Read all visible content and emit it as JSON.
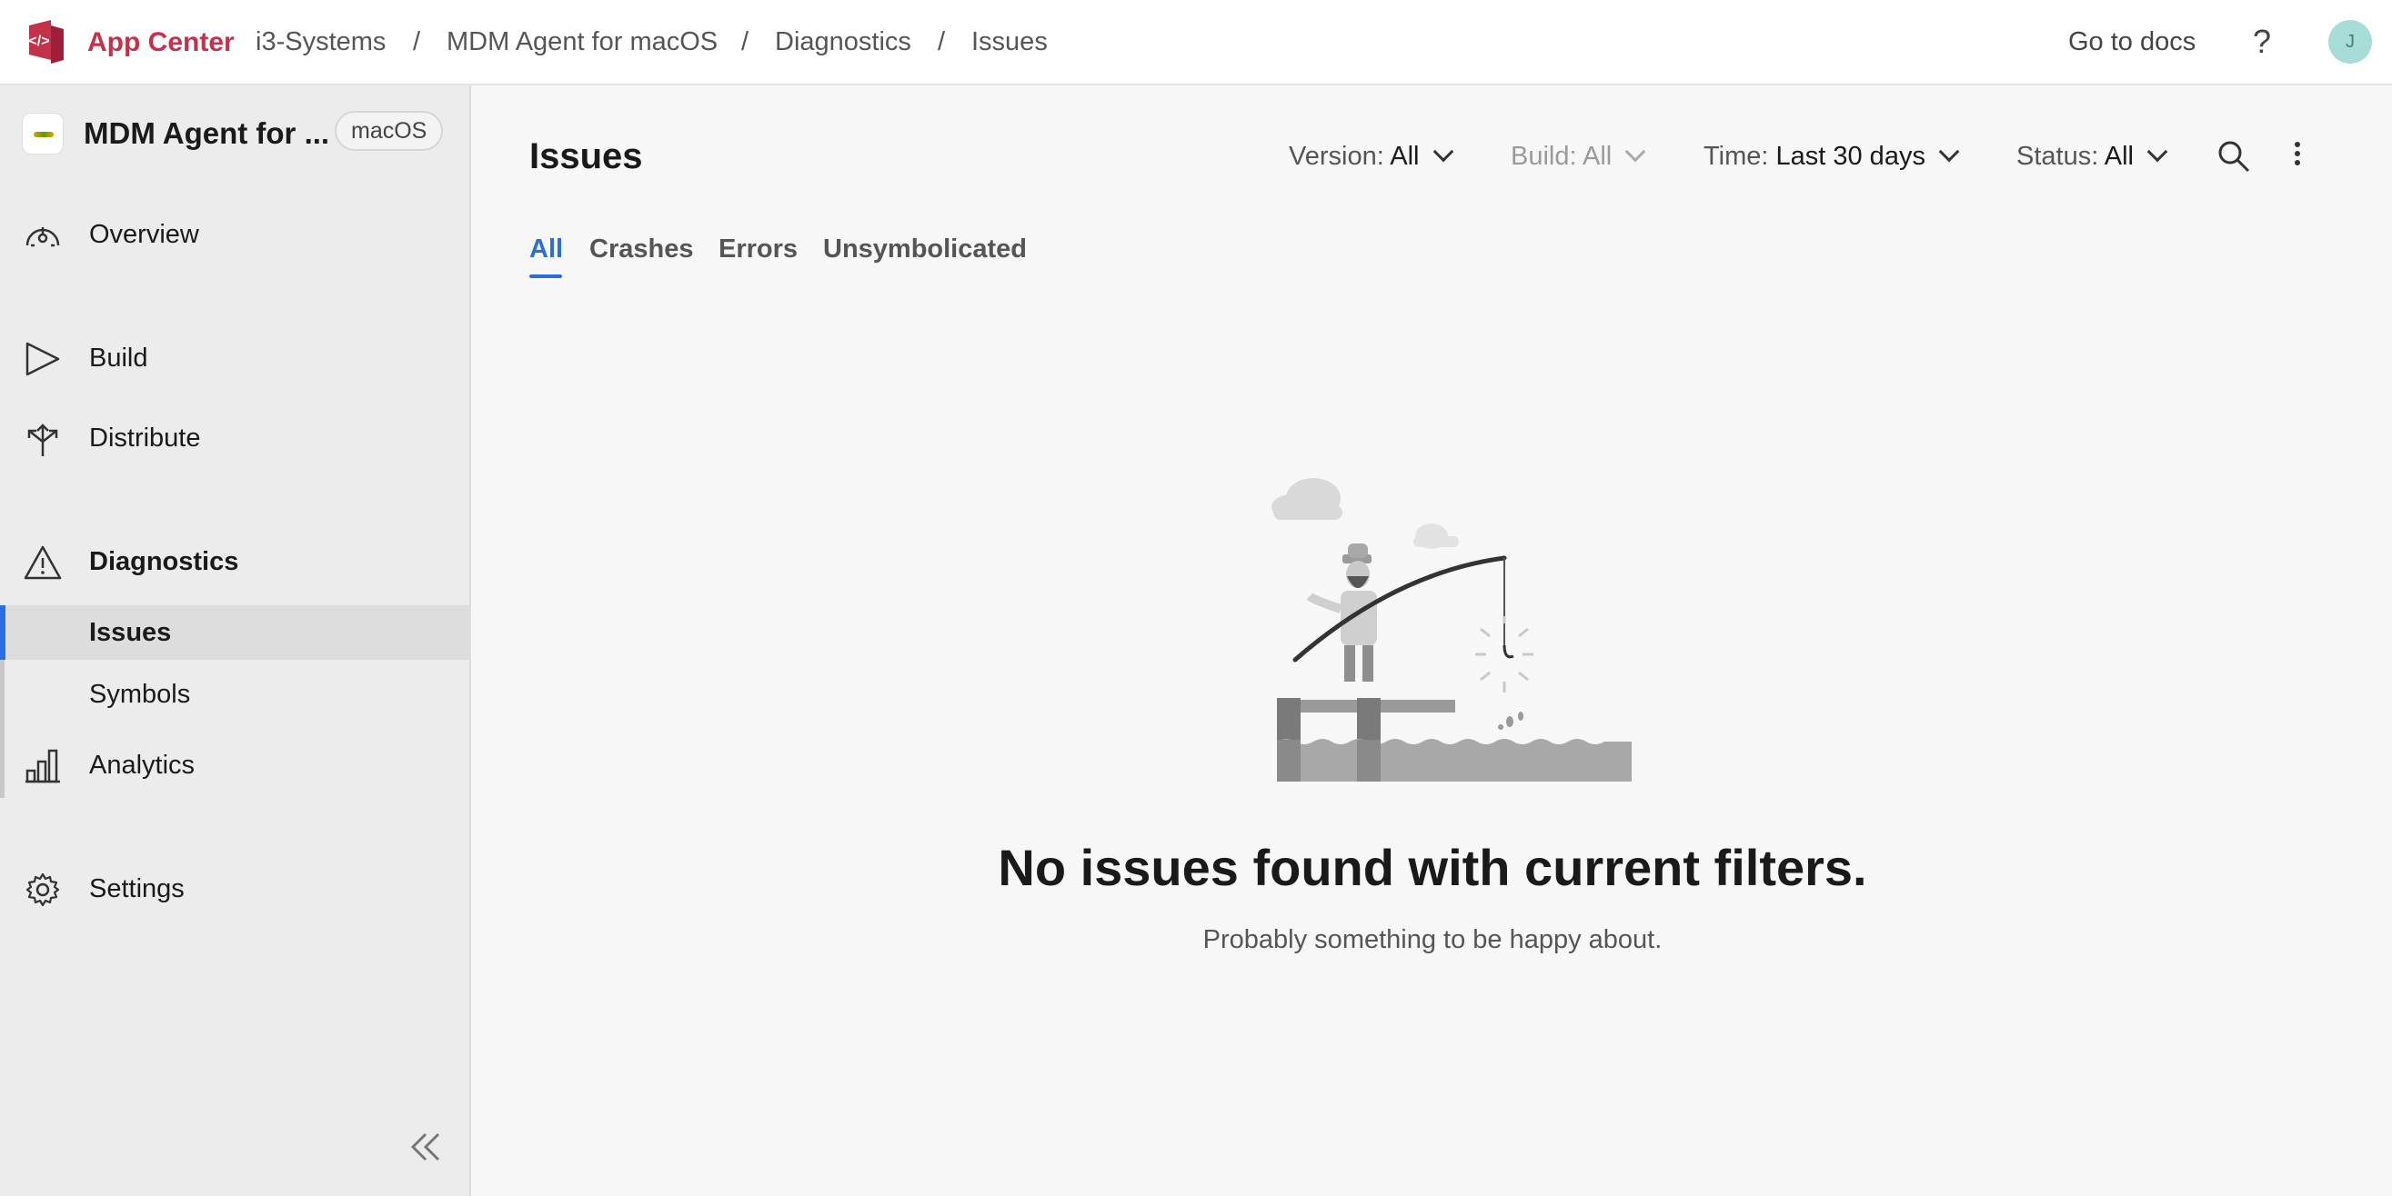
{
  "topbar": {
    "brand": "App Center",
    "breadcrumbs": [
      "i3-Systems",
      "MDM Agent for macOS",
      "Diagnostics",
      "Issues"
    ],
    "separator": "/",
    "docs_link": "Go to docs",
    "help_icon": "?",
    "avatar_initial": "J"
  },
  "sidebar": {
    "app_name": "MDM Agent for ...",
    "platform": "macOS",
    "items": {
      "overview": "Overview",
      "build": "Build",
      "distribute": "Distribute",
      "diagnostics": "Diagnostics",
      "issues": "Issues",
      "symbols": "Symbols",
      "analytics": "Analytics",
      "settings": "Settings"
    },
    "active_item": "Issues"
  },
  "main": {
    "title": "Issues",
    "filters": {
      "version": {
        "label": "Version:",
        "value": "All"
      },
      "build": {
        "label": "Build:",
        "value": "All"
      },
      "time": {
        "label": "Time:",
        "value": "Last 30 days"
      },
      "status": {
        "label": "Status:",
        "value": "All"
      }
    },
    "tabs": [
      "All",
      "Crashes",
      "Errors",
      "Unsymbolicated"
    ],
    "active_tab": "All",
    "empty_state": {
      "title": "No issues found with current filters.",
      "subtitle": "Probably something to be happy about."
    }
  },
  "colors": {
    "brand": "#c4314b",
    "accent": "#2a6fdb",
    "sidebar_bg": "#ececec",
    "main_bg": "#f7f7f7"
  }
}
